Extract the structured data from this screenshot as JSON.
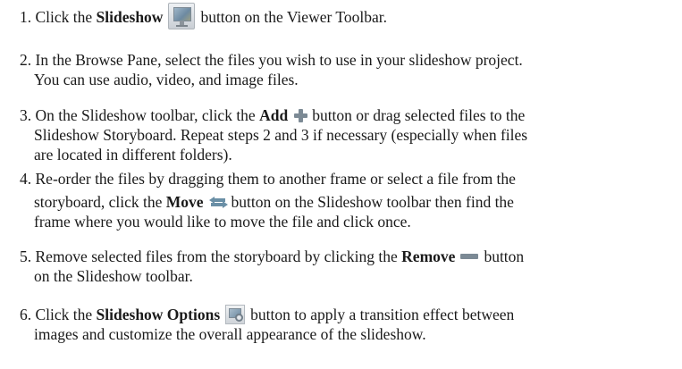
{
  "steps": [
    {
      "num": "1.",
      "lines": [
        {
          "pre": "Click the",
          "bold": "Slideshow",
          "post": "button on the Viewer Toolbar.",
          "icon": "slideshow-icon"
        }
      ]
    },
    {
      "num": "2.",
      "lines": [
        {
          "text": "In the Browse Pane, select the files you wish to use in your slideshow project."
        },
        {
          "text": "You can use audio, video, and image files."
        }
      ]
    },
    {
      "num": "3.",
      "lines": [
        {
          "pre": "On the Slideshow toolbar, click the",
          "bold": "Add",
          "post": "button or drag selected files to the",
          "icon": "add-icon"
        },
        {
          "text": "Slideshow Storyboard. Repeat steps 2 and 3 if necessary (especially when files"
        },
        {
          "text": "are located in different folders)."
        }
      ]
    },
    {
      "num": "4.",
      "lines": [
        {
          "text": "Re-order the files by dragging them to another frame or select a file from the"
        },
        {
          "pre": "storyboard, click the",
          "bold": "Move",
          "post": "button on the Slideshow toolbar then find the",
          "icon": "move-icon"
        },
        {
          "text": "frame where you would like to move the file and click once."
        }
      ]
    },
    {
      "num": "5.",
      "lines": [
        {
          "pre": "Remove selected files from the storyboard by clicking the",
          "bold": "Remove",
          "post": "button",
          "icon": "remove-icon"
        },
        {
          "text": "on the Slideshow toolbar."
        }
      ]
    },
    {
      "num": "6.",
      "lines": [
        {
          "pre": "Click the",
          "bold": "Slideshow Options",
          "post": "button to apply a transition effect between",
          "icon": "slideshow-options-icon"
        },
        {
          "text": "images and customize the overall appearance of the slideshow."
        }
      ]
    }
  ]
}
